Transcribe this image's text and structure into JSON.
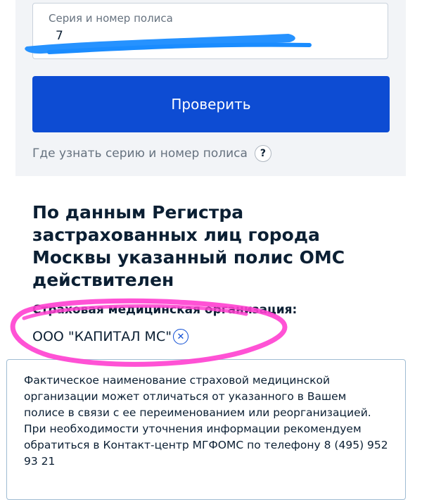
{
  "form": {
    "field_label": "Серия и номер полиса",
    "field_value": "7",
    "check_button": "Проверить",
    "help_link": "Где узнать серию и номер полиса",
    "help_icon": "?"
  },
  "result": {
    "heading": "По данным Регистра застрахованных лиц города Москвы указанный полис ОМС действителен",
    "org_label": "Страховая медицинская организация:",
    "org_value": "ООО \"КАПИТАЛ МС\"",
    "close_icon": "✕"
  },
  "tooltip": {
    "text": "Фактическое наименование страховой медицинской организации может отличаться от указанного в Вашем полисе в связи с ее переименованием или реорганизацией. При необходимости уточнения информации рекомендуем обратиться в Контакт-центр МГФОМС по телефону 8 (495) 952 93 21"
  },
  "colors": {
    "primary": "#0d4cd3",
    "card_bg": "#f2f4f7",
    "redaction": "#1a8cff",
    "marker": "#ff3fd0"
  }
}
